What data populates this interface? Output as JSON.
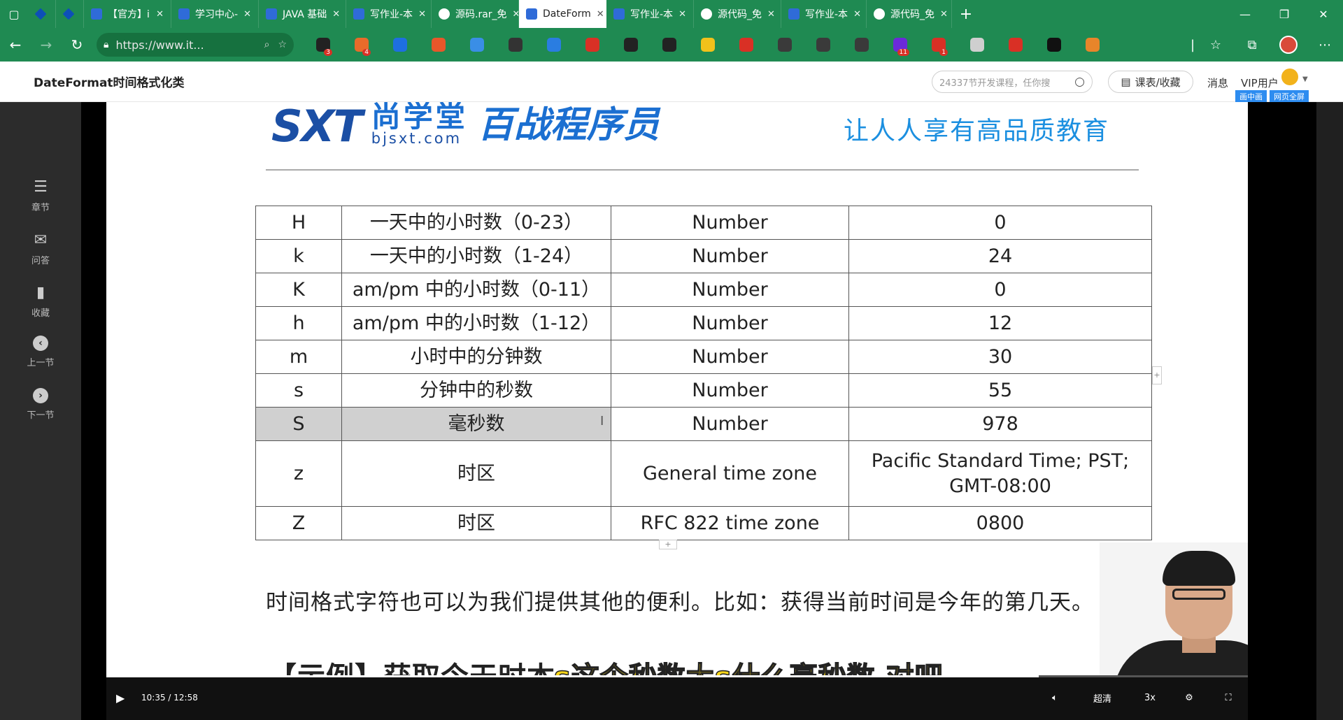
{
  "tabs": [
    {
      "label": "",
      "icon": "gem-icon",
      "active": false
    },
    {
      "label": "",
      "icon": "gem-icon",
      "active": false
    },
    {
      "label": "【官方】i",
      "icon": "doc-icon",
      "active": false
    },
    {
      "label": "学习中心-",
      "icon": "doc-icon",
      "active": false
    },
    {
      "label": "JAVA 基础",
      "icon": "doc-icon",
      "active": false
    },
    {
      "label": "写作业-本",
      "icon": "doc-icon",
      "active": false
    },
    {
      "label": "源码.rar_免",
      "icon": "cloud-icon",
      "active": false
    },
    {
      "label": "DateForm",
      "icon": "doc-icon",
      "active": true
    },
    {
      "label": "写作业-本",
      "icon": "doc-icon",
      "active": false
    },
    {
      "label": "源代码_免",
      "icon": "cloud-icon",
      "active": false
    },
    {
      "label": "写作业-本",
      "icon": "doc-icon",
      "active": false
    },
    {
      "label": "源代码_免",
      "icon": "cloud-icon",
      "active": false
    }
  ],
  "address": {
    "url": "https://www.it..."
  },
  "extensions": [
    {
      "name": "ext-1-icon",
      "color": "#222222",
      "badge": "3"
    },
    {
      "name": "ext-2-icon",
      "color": "#e86b2a",
      "badge": "4"
    },
    {
      "name": "ext-3-icon",
      "color": "#1e6fe0",
      "badge": ""
    },
    {
      "name": "ext-4-icon",
      "color": "#e8572a",
      "badge": ""
    },
    {
      "name": "ext-5-icon",
      "color": "#3a8ee6",
      "badge": ""
    },
    {
      "name": "ext-6-icon",
      "color": "#333333",
      "badge": ""
    },
    {
      "name": "ext-7-icon",
      "color": "#2a7de1",
      "badge": ""
    },
    {
      "name": "adblock-icon",
      "color": "#d93025",
      "badge": ""
    },
    {
      "name": "ext-9-icon",
      "color": "#222222",
      "badge": ""
    },
    {
      "name": "ext-10-icon",
      "color": "#222222",
      "badge": ""
    },
    {
      "name": "ext-11-icon",
      "color": "#f2c11b",
      "badge": ""
    },
    {
      "name": "ext-12-icon",
      "color": "#d93025",
      "badge": ""
    },
    {
      "name": "ext-13-icon",
      "color": "#3a3a3a",
      "badge": ""
    },
    {
      "name": "ext-14-icon",
      "color": "#3a3a3a",
      "badge": ""
    },
    {
      "name": "ext-15-icon",
      "color": "#3a3a3a",
      "badge": ""
    },
    {
      "name": "ext-16-icon",
      "color": "#6b2ad9",
      "badge": "11"
    },
    {
      "name": "ext-17-icon",
      "color": "#d93025",
      "badge": "1"
    },
    {
      "name": "camera-icon",
      "color": "#cfcfcf",
      "badge": ""
    },
    {
      "name": "ext-19-icon",
      "color": "#d93025",
      "badge": ""
    },
    {
      "name": "ext-20-icon",
      "color": "#111111",
      "badge": ""
    },
    {
      "name": "metamask-icon",
      "color": "#e8852a",
      "badge": ""
    }
  ],
  "site": {
    "title": "DateFormat时间格式化类",
    "search_placeholder": "24337节开发课程，任你搜",
    "course_btn": "课表/收藏",
    "messages": "消息",
    "vip": "VIP用户",
    "pip": "画中画",
    "fullscreen_web": "网页全屏"
  },
  "side_nav": [
    {
      "label": "章节",
      "icon": "chapter-icon",
      "glyph": "☰"
    },
    {
      "label": "问答",
      "icon": "qa-icon",
      "glyph": "✉"
    },
    {
      "label": "收藏",
      "icon": "bookmark-icon",
      "glyph": "▮"
    },
    {
      "label": "上一节",
      "icon": "prev-icon",
      "glyph": "‹"
    },
    {
      "label": "下一节",
      "icon": "next-icon",
      "glyph": "›"
    }
  ],
  "slide": {
    "logo_sxt": "SXT",
    "logo_cn": "尚学堂",
    "logo_url": "bjsxt.com",
    "logo_brand": "百战程序员",
    "slogan": "让人人享有高品质教育",
    "table": [
      [
        "H",
        "一天中的小时数（0-23）",
        "Number",
        "0"
      ],
      [
        "k",
        "一天中的小时数（1-24）",
        "Number",
        "24"
      ],
      [
        "K",
        "am/pm 中的小时数（0-11）",
        "Number",
        "0"
      ],
      [
        "h",
        "am/pm 中的小时数（1-12）",
        "Number",
        "12"
      ],
      [
        "m",
        "小时中的分钟数",
        "Number",
        "30"
      ],
      [
        "s",
        "分钟中的秒数",
        "Number",
        "55"
      ],
      [
        "S",
        "毫秒数",
        "Number",
        "978"
      ],
      [
        "z",
        "时区",
        "General time zone",
        "Pacific Standard Time; PST; GMT-08:00"
      ],
      [
        "Z",
        "时区",
        "RFC 822 time zone",
        "0800"
      ]
    ],
    "paragraph": "时间格式字符也可以为我们提供其他的便利。比如：获得当前时间是今年的第几天。",
    "example_heading": "【示例】获取今天时本",
    "subtitle": "s这个秒数大s什么毫秒数 对吧"
  },
  "player": {
    "current_time": "10:35",
    "duration": "12:58",
    "time_sep": " / ",
    "progress": 0.817,
    "quality": "超清",
    "speed": "3x"
  }
}
